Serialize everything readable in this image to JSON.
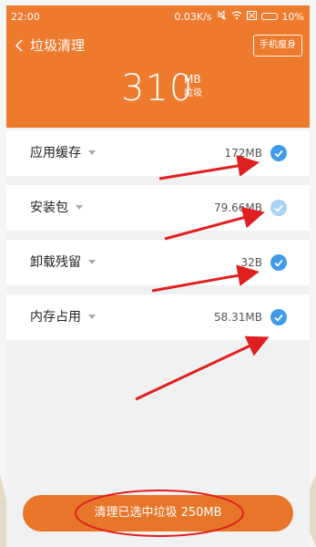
{
  "status_bar": {
    "time": "22:00",
    "speed": "0.03K/s",
    "battery": "10%"
  },
  "header": {
    "back_icon": "chevron-left-icon",
    "title": "垃圾清理",
    "slim_button": "手机瘦身",
    "total_value": "310",
    "total_unit": "MB",
    "total_sub": "垃圾"
  },
  "items": [
    {
      "label": "应用缓存",
      "size": "172MB",
      "checked": true
    },
    {
      "label": "安装包",
      "size": "79.66MB",
      "checked": true
    },
    {
      "label": "卸载残留",
      "size": "32B",
      "checked": true
    },
    {
      "label": "内存占用",
      "size": "58.31MB",
      "checked": true
    }
  ],
  "bottom_button": "清理已选中垃圾 250MB",
  "colors": {
    "header": "#ee7a2d",
    "check": "#3f9bea",
    "annotation": "#e02020"
  }
}
